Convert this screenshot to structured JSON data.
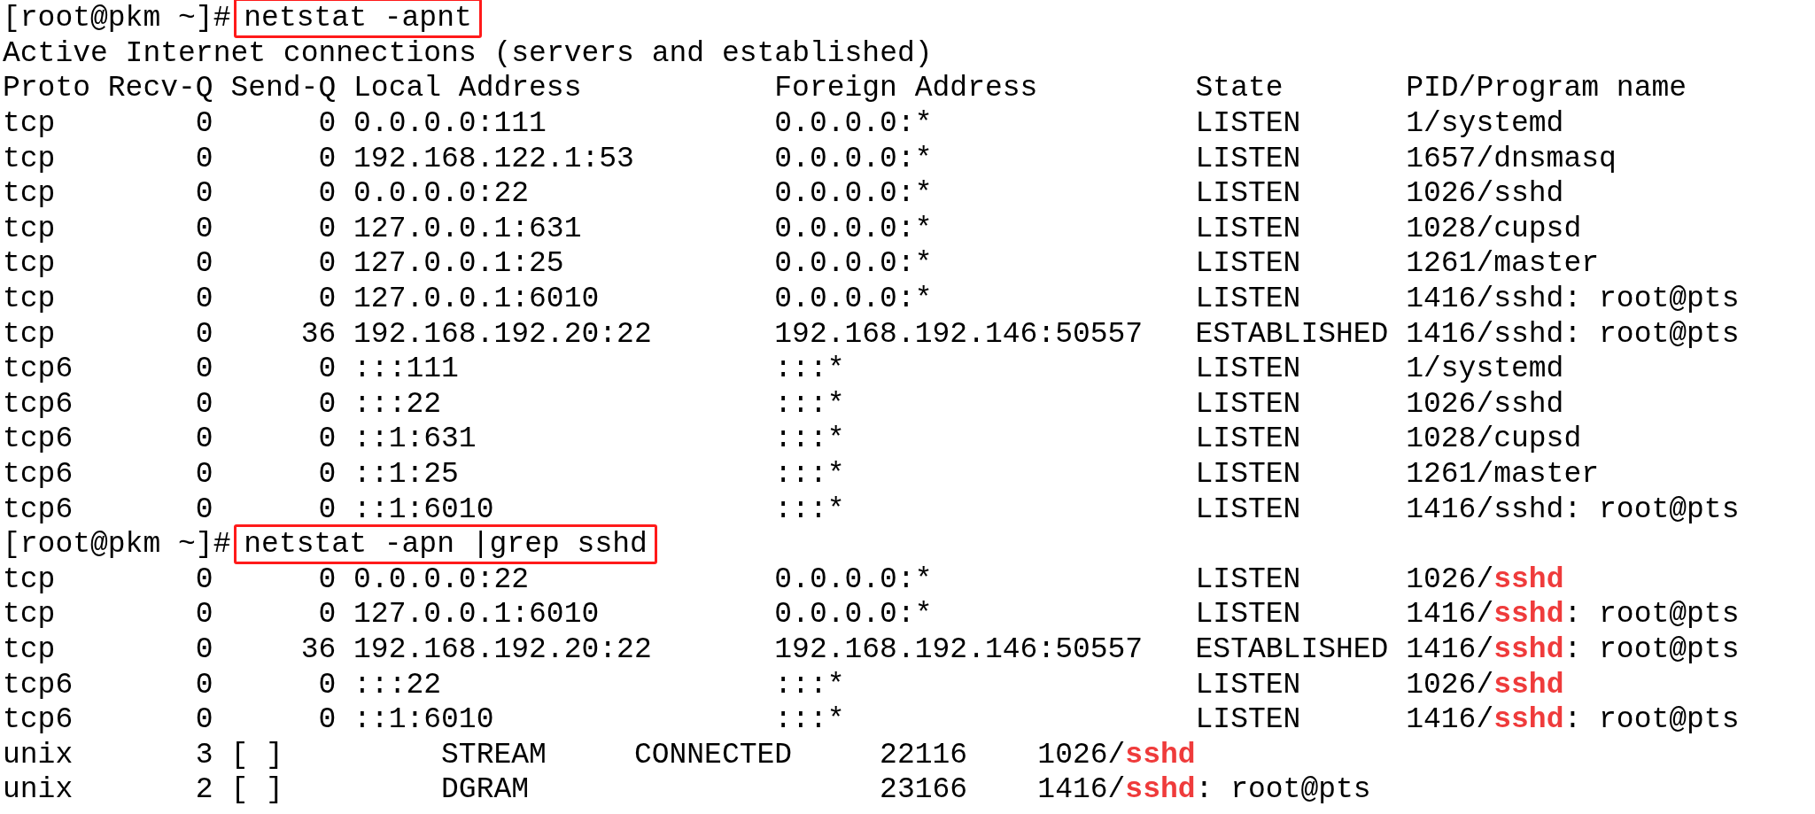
{
  "lines": [
    {
      "kind": "command",
      "prompt": "[root@pkm ~]#",
      "command": "netstat -apnt",
      "highlighted": true
    },
    {
      "kind": "text",
      "text": "Active Internet connections (servers and established)"
    },
    {
      "kind": "header",
      "proto": "Proto",
      "recv_q": "Recv-Q",
      "send_q": "Send-Q",
      "local": "Local Address",
      "foreign": "Foreign Address",
      "state": "State",
      "pid": "PID/Program name"
    },
    {
      "kind": "inet",
      "proto": "tcp",
      "recv_q": "0",
      "send_q": "0",
      "local": "0.0.0.0:111",
      "foreign": "0.0.0.0:*",
      "state": "LISTEN",
      "pid": [
        {
          "text": "1/systemd",
          "match": false
        }
      ]
    },
    {
      "kind": "inet",
      "proto": "tcp",
      "recv_q": "0",
      "send_q": "0",
      "local": "192.168.122.1:53",
      "foreign": "0.0.0.0:*",
      "state": "LISTEN",
      "pid": [
        {
          "text": "1657/dnsmasq",
          "match": false
        }
      ]
    },
    {
      "kind": "inet",
      "proto": "tcp",
      "recv_q": "0",
      "send_q": "0",
      "local": "0.0.0.0:22",
      "foreign": "0.0.0.0:*",
      "state": "LISTEN",
      "pid": [
        {
          "text": "1026/sshd",
          "match": false
        }
      ]
    },
    {
      "kind": "inet",
      "proto": "tcp",
      "recv_q": "0",
      "send_q": "0",
      "local": "127.0.0.1:631",
      "foreign": "0.0.0.0:*",
      "state": "LISTEN",
      "pid": [
        {
          "text": "1028/cupsd",
          "match": false
        }
      ]
    },
    {
      "kind": "inet",
      "proto": "tcp",
      "recv_q": "0",
      "send_q": "0",
      "local": "127.0.0.1:25",
      "foreign": "0.0.0.0:*",
      "state": "LISTEN",
      "pid": [
        {
          "text": "1261/master",
          "match": false
        }
      ]
    },
    {
      "kind": "inet",
      "proto": "tcp",
      "recv_q": "0",
      "send_q": "0",
      "local": "127.0.0.1:6010",
      "foreign": "0.0.0.0:*",
      "state": "LISTEN",
      "pid": [
        {
          "text": "1416/sshd: root@pts",
          "match": false
        }
      ]
    },
    {
      "kind": "inet",
      "proto": "tcp",
      "recv_q": "0",
      "send_q": "36",
      "local": "192.168.192.20:22",
      "foreign": "192.168.192.146:50557",
      "state": "ESTABLISHED",
      "pid": [
        {
          "text": "1416/sshd: root@pts",
          "match": false
        }
      ]
    },
    {
      "kind": "inet",
      "proto": "tcp6",
      "recv_q": "0",
      "send_q": "0",
      "local": ":::111",
      "foreign": ":::*",
      "state": "LISTEN",
      "pid": [
        {
          "text": "1/systemd",
          "match": false
        }
      ]
    },
    {
      "kind": "inet",
      "proto": "tcp6",
      "recv_q": "0",
      "send_q": "0",
      "local": ":::22",
      "foreign": ":::*",
      "state": "LISTEN",
      "pid": [
        {
          "text": "1026/sshd",
          "match": false
        }
      ]
    },
    {
      "kind": "inet",
      "proto": "tcp6",
      "recv_q": "0",
      "send_q": "0",
      "local": "::1:631",
      "foreign": ":::*",
      "state": "LISTEN",
      "pid": [
        {
          "text": "1028/cupsd",
          "match": false
        }
      ]
    },
    {
      "kind": "inet",
      "proto": "tcp6",
      "recv_q": "0",
      "send_q": "0",
      "local": "::1:25",
      "foreign": ":::*",
      "state": "LISTEN",
      "pid": [
        {
          "text": "1261/master",
          "match": false
        }
      ]
    },
    {
      "kind": "inet",
      "proto": "tcp6",
      "recv_q": "0",
      "send_q": "0",
      "local": "::1:6010",
      "foreign": ":::*",
      "state": "LISTEN",
      "pid": [
        {
          "text": "1416/sshd: root@pts",
          "match": false
        }
      ]
    },
    {
      "kind": "command",
      "prompt": "[root@pkm ~]#",
      "command": "netstat -apn |grep sshd",
      "highlighted": true
    },
    {
      "kind": "inet",
      "proto": "tcp",
      "recv_q": "0",
      "send_q": "0",
      "local": "0.0.0.0:22",
      "foreign": "0.0.0.0:*",
      "state": "LISTEN",
      "pid": [
        {
          "text": "1026/",
          "match": false
        },
        {
          "text": "sshd",
          "match": true
        }
      ]
    },
    {
      "kind": "inet",
      "proto": "tcp",
      "recv_q": "0",
      "send_q": "0",
      "local": "127.0.0.1:6010",
      "foreign": "0.0.0.0:*",
      "state": "LISTEN",
      "pid": [
        {
          "text": "1416/",
          "match": false
        },
        {
          "text": "sshd",
          "match": true
        },
        {
          "text": ": root@pts",
          "match": false
        }
      ]
    },
    {
      "kind": "inet",
      "proto": "tcp",
      "recv_q": "0",
      "send_q": "36",
      "local": "192.168.192.20:22",
      "foreign": "192.168.192.146:50557",
      "state": "ESTABLISHED",
      "pid": [
        {
          "text": "1416/",
          "match": false
        },
        {
          "text": "sshd",
          "match": true
        },
        {
          "text": ": root@pts",
          "match": false
        }
      ]
    },
    {
      "kind": "inet",
      "proto": "tcp6",
      "recv_q": "0",
      "send_q": "0",
      "local": ":::22",
      "foreign": ":::*",
      "state": "LISTEN",
      "pid": [
        {
          "text": "1026/",
          "match": false
        },
        {
          "text": "sshd",
          "match": true
        }
      ]
    },
    {
      "kind": "inet",
      "proto": "tcp6",
      "recv_q": "0",
      "send_q": "0",
      "local": "::1:6010",
      "foreign": ":::*",
      "state": "LISTEN",
      "pid": [
        {
          "text": "1416/",
          "match": false
        },
        {
          "text": "sshd",
          "match": true
        },
        {
          "text": ": root@pts",
          "match": false
        }
      ]
    },
    {
      "kind": "unix",
      "proto": "unix",
      "refcnt": "3",
      "flags": "[ ]",
      "type": "STREAM",
      "state": "CONNECTED",
      "inode": "22116",
      "pid": [
        {
          "text": "1026/",
          "match": false
        },
        {
          "text": "sshd",
          "match": true
        }
      ]
    },
    {
      "kind": "unix",
      "proto": "unix",
      "refcnt": "2",
      "flags": "[ ]",
      "type": "DGRAM",
      "inode": "23166",
      "pid": [
        {
          "text": "1416/",
          "match": false
        },
        {
          "text": "sshd",
          "match": true
        },
        {
          "text": ": root@pts",
          "match": false
        }
      ]
    }
  ]
}
